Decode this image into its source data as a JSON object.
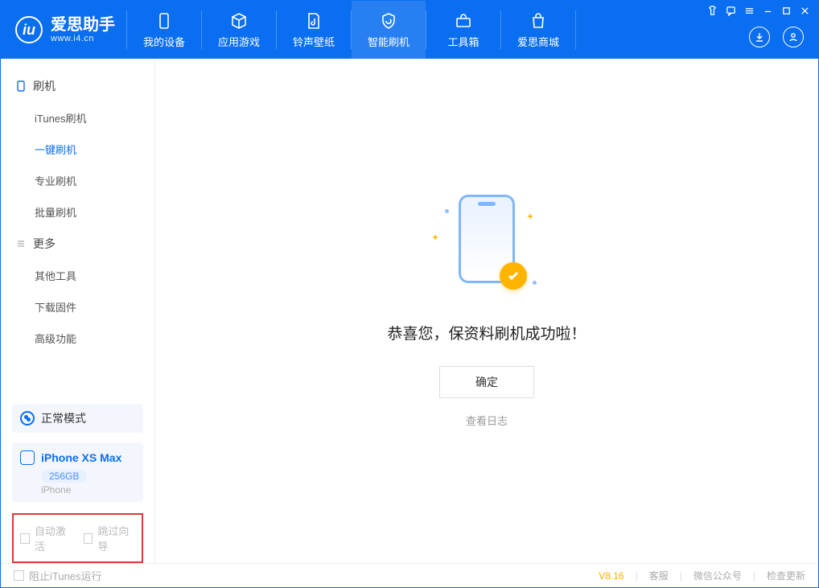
{
  "brand": {
    "title": "爱思助手",
    "subtitle": "www.i4.cn"
  },
  "nav": {
    "my_device": "我的设备",
    "apps_games": "应用游戏",
    "ring_wall": "铃声壁纸",
    "smart_flash": "智能刷机",
    "toolbox": "工具箱",
    "store": "爱思商城"
  },
  "sidebar": {
    "section_flash": "刷机",
    "items_flash": [
      "iTunes刷机",
      "一键刷机",
      "专业刷机",
      "批量刷机"
    ],
    "section_more": "更多",
    "items_more": [
      "其他工具",
      "下载固件",
      "高级功能"
    ]
  },
  "mode": {
    "label": "正常模式"
  },
  "device": {
    "name": "iPhone XS Max",
    "capacity": "256GB",
    "type": "iPhone"
  },
  "options": {
    "auto_activate": "自动激活",
    "skip_guide": "跳过向导"
  },
  "main": {
    "success": "恭喜您，保资料刷机成功啦！",
    "ok": "确定",
    "view_log": "查看日志"
  },
  "footer": {
    "block_itunes": "阻止iTunes运行",
    "version": "V8.16",
    "support": "客服",
    "wechat": "微信公众号",
    "check_update": "检查更新"
  }
}
